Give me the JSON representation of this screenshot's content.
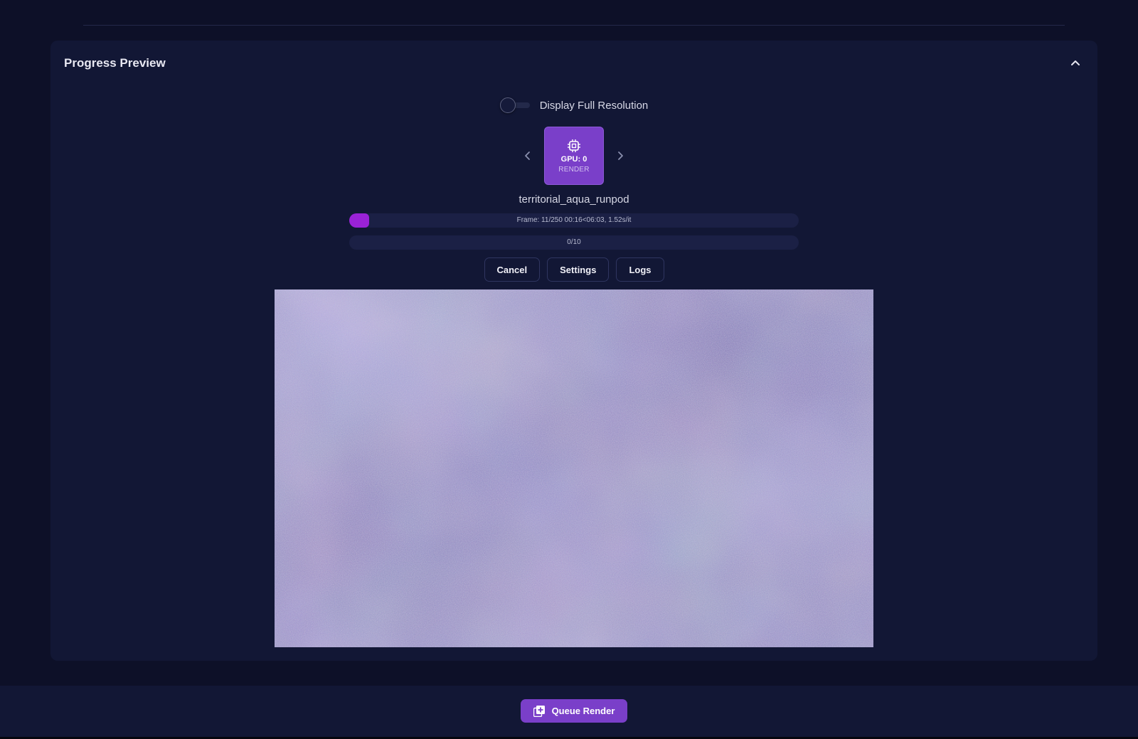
{
  "panel": {
    "title": "Progress Preview"
  },
  "toggle": {
    "label": "Display Full Resolution",
    "on": false
  },
  "gpu": {
    "name": "GPU: 0",
    "role": "RENDER",
    "icon": "chip-icon"
  },
  "job": {
    "name": "territorial_aqua_runpod"
  },
  "progress": {
    "frame_text": "Frame: 11/250 00:16<06:03, 1.52s/it",
    "frame_fraction": 0.044,
    "batch_text": "0/10",
    "batch_fraction": 0
  },
  "actions": {
    "cancel": "Cancel",
    "settings": "Settings",
    "logs": "Logs"
  },
  "footer": {
    "queue_label": "Queue Render",
    "queue_icon": "queue-add-icon"
  },
  "colors": {
    "accent": "#7a3fc9",
    "progress_fill": "#9a22d6",
    "background": "#0d1028",
    "panel": "#121735"
  }
}
